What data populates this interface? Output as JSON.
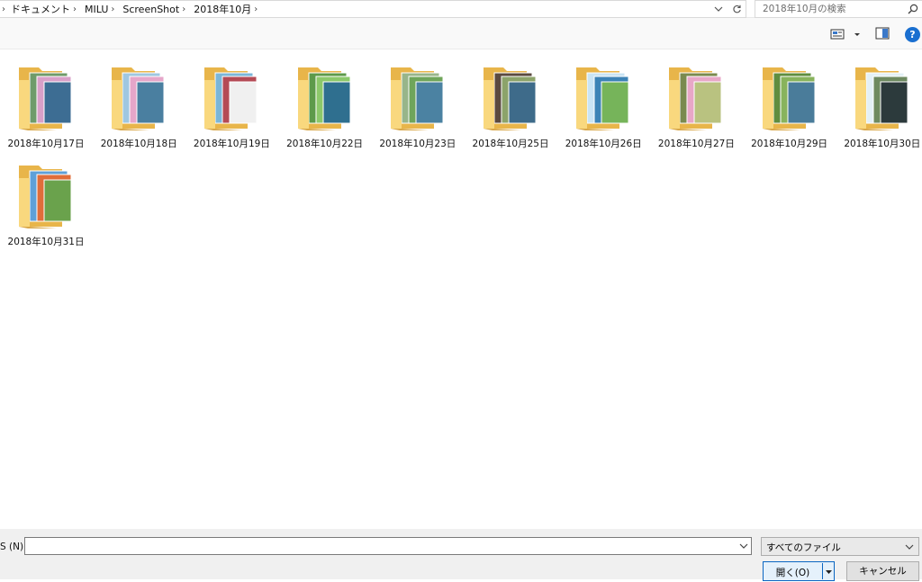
{
  "address_bar": {
    "crumbs": [
      "ドキュメント",
      "MILU",
      "ScreenShot",
      "2018年10月"
    ]
  },
  "search": {
    "placeholder": "2018年10月の検索"
  },
  "toolbar": {
    "view_icon": "view-options-icon",
    "preview_icon": "preview-pane-icon",
    "help_glyph": "?"
  },
  "folders": [
    {
      "name": "2018年10月17日"
    },
    {
      "name": "2018年10月18日"
    },
    {
      "name": "2018年10月19日"
    },
    {
      "name": "2018年10月22日"
    },
    {
      "name": "2018年10月23日"
    },
    {
      "name": "2018年10月25日"
    },
    {
      "name": "2018年10月26日"
    },
    {
      "name": "2018年10月27日"
    },
    {
      "name": "2018年10月29日"
    },
    {
      "name": "2018年10月30日"
    },
    {
      "name": "2018年10月31日"
    }
  ],
  "bottom": {
    "filename_label": "S (N):",
    "filename_value": "",
    "filetype_selected": "すべてのファイル",
    "open_label": "開く(O)",
    "cancel_label": "キャンセル"
  },
  "colors": {
    "folder_back": "#e8b54a",
    "folder_front": "#f9d87e",
    "accent": "#0a66c2"
  }
}
